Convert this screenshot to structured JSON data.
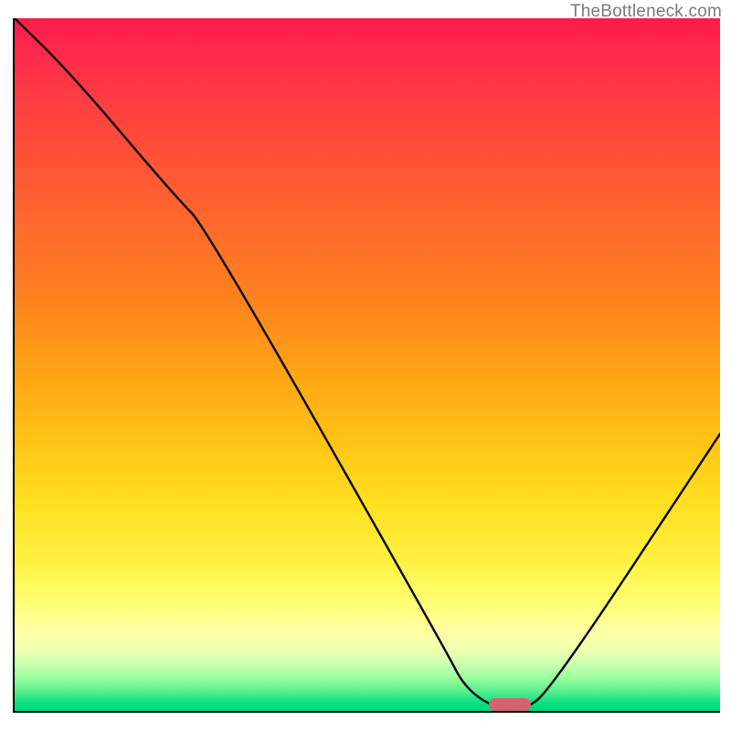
{
  "watermark": "TheBottleneck.com",
  "chart_data": {
    "type": "line",
    "title": "",
    "xlabel": "",
    "ylabel": "",
    "xlim": [
      0,
      100
    ],
    "ylim": [
      0,
      100
    ],
    "series": [
      {
        "name": "bottleneck-curve",
        "x": [
          0,
          8,
          23,
          27,
          61,
          64,
          69,
          72,
          76,
          100
        ],
        "y": [
          100,
          92,
          74,
          70,
          9,
          3,
          0,
          0,
          3,
          40
        ]
      }
    ],
    "marker": {
      "x_center": 70,
      "width_pct": 6,
      "color": "#d4636f"
    },
    "gradient_colors": {
      "top": "#ff1a4d",
      "mid1": "#ff8020",
      "mid2": "#ffe020",
      "mid3": "#ffffa0",
      "bottom": "#00d878"
    }
  }
}
